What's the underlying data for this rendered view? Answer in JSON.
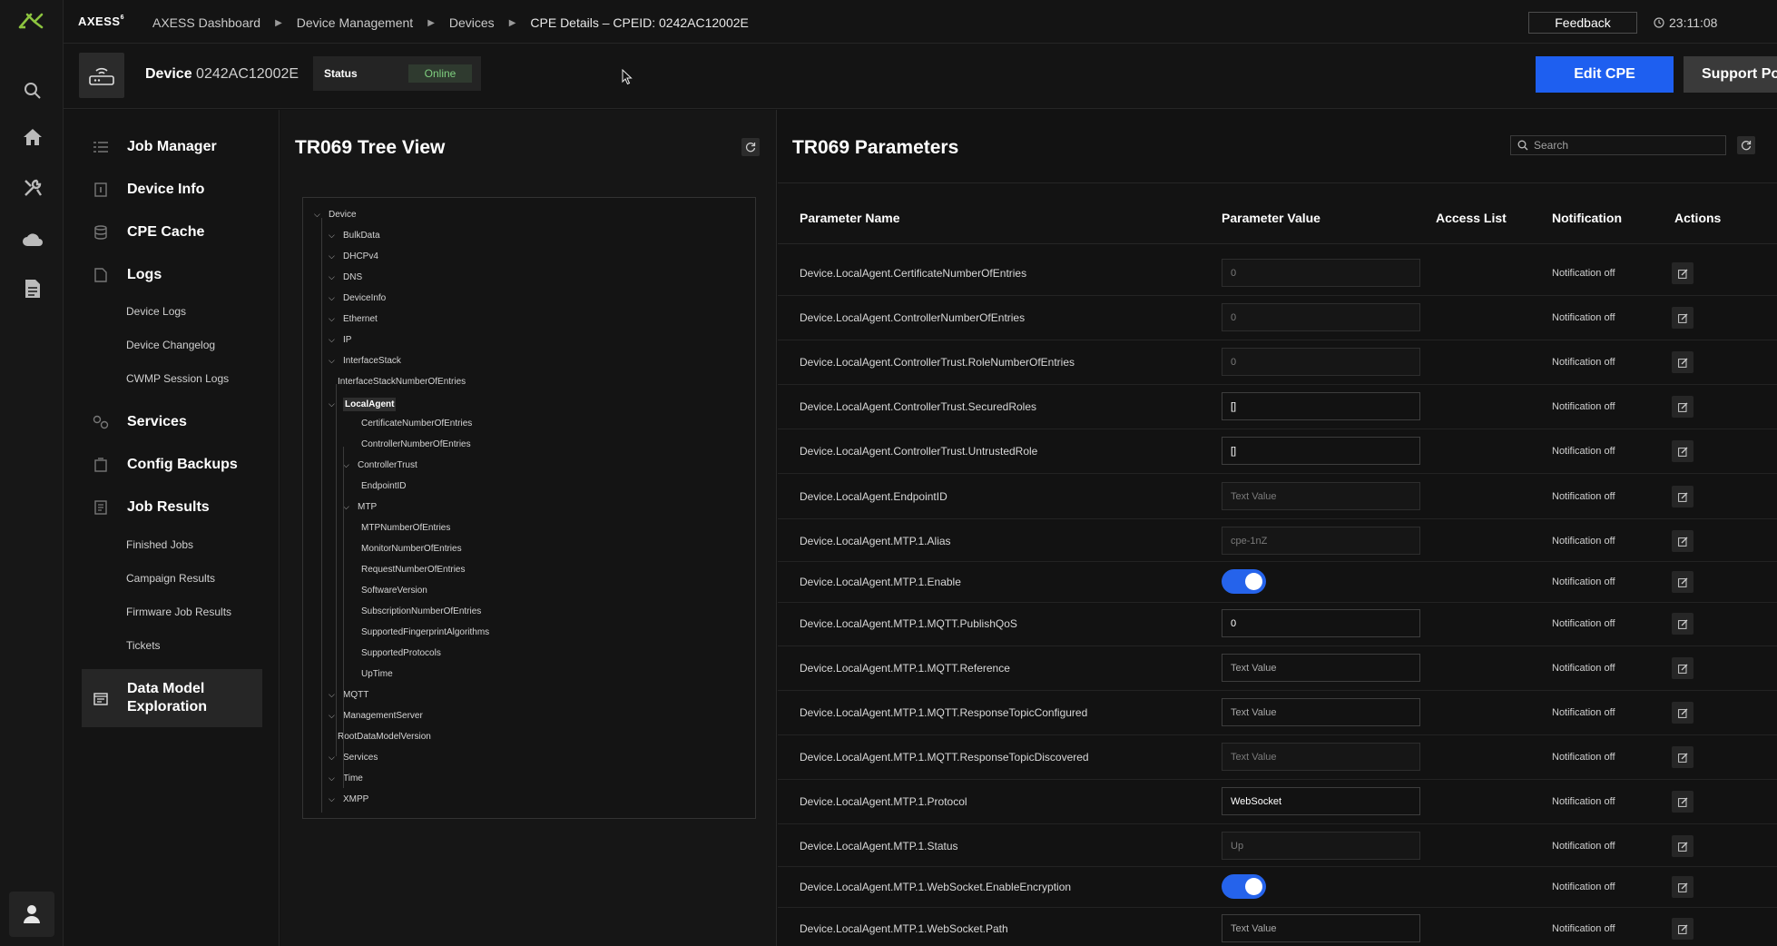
{
  "topbar": {
    "brand": "AXESS",
    "brand_version": "6",
    "breadcrumbs": [
      "AXESS Dashboard",
      "Device Management",
      "Devices",
      "CPE Details – CPEID: 0242AC12002E"
    ],
    "feedback_label": "Feedback",
    "time": "23:11:08"
  },
  "device": {
    "title_label": "Device",
    "id": "0242AC12002E",
    "status_label": "Status",
    "status_value": "Online",
    "edit_label": "Edit CPE",
    "support_label": "Support Portal"
  },
  "rail_icons": [
    "search-icon",
    "home-icon",
    "tools-icon",
    "cloud-icon",
    "document-icon",
    "user-icon"
  ],
  "nav": {
    "job_manager": "Job Manager",
    "device_info": "Device Info",
    "cpe_cache": "CPE Cache",
    "logs": "Logs",
    "logs_sub": [
      "Device Logs",
      "Device Changelog",
      "CWMP Session Logs"
    ],
    "services": "Services",
    "config_backups": "Config Backups",
    "job_results": "Job Results",
    "job_results_sub": [
      "Finished Jobs",
      "Campaign Results",
      "Firmware Job Results",
      "Tickets"
    ],
    "data_model_line1": "Data Model",
    "data_model_line2": "Exploration"
  },
  "tree": {
    "title": "TR069 Tree View",
    "nodes": [
      {
        "label": "Device",
        "level": 0,
        "expandable": true
      },
      {
        "label": "BulkData",
        "level": 1,
        "expandable": true
      },
      {
        "label": "DHCPv4",
        "level": 1,
        "expandable": true
      },
      {
        "label": "DNS",
        "level": 1,
        "expandable": true
      },
      {
        "label": "DeviceInfo",
        "level": 1,
        "expandable": true
      },
      {
        "label": "Ethernet",
        "level": 1,
        "expandable": true
      },
      {
        "label": "IP",
        "level": 1,
        "expandable": true
      },
      {
        "label": "InterfaceStack",
        "level": 1,
        "expandable": true
      },
      {
        "label": "InterfaceStackNumberOfEntries",
        "level": 1,
        "expandable": false
      },
      {
        "label": "LocalAgent",
        "level": 1,
        "expandable": true,
        "selected": true
      },
      {
        "label": "CertificateNumberOfEntries",
        "level": 2,
        "expandable": false
      },
      {
        "label": "ControllerNumberOfEntries",
        "level": 2,
        "expandable": false
      },
      {
        "label": "ControllerTrust",
        "level": 2,
        "expandable": true
      },
      {
        "label": "EndpointID",
        "level": 2,
        "expandable": false
      },
      {
        "label": "MTP",
        "level": 2,
        "expandable": true
      },
      {
        "label": "MTPNumberOfEntries",
        "level": 2,
        "expandable": false
      },
      {
        "label": "MonitorNumberOfEntries",
        "level": 2,
        "expandable": false
      },
      {
        "label": "RequestNumberOfEntries",
        "level": 2,
        "expandable": false
      },
      {
        "label": "SoftwareVersion",
        "level": 2,
        "expandable": false
      },
      {
        "label": "SubscriptionNumberOfEntries",
        "level": 2,
        "expandable": false
      },
      {
        "label": "SupportedFingerprintAlgorithms",
        "level": 2,
        "expandable": false
      },
      {
        "label": "SupportedProtocols",
        "level": 2,
        "expandable": false
      },
      {
        "label": "UpTime",
        "level": 2,
        "expandable": false
      },
      {
        "label": "MQTT",
        "level": 1,
        "expandable": true
      },
      {
        "label": "ManagementServer",
        "level": 1,
        "expandable": true
      },
      {
        "label": "RootDataModelVersion",
        "level": 1,
        "expandable": false
      },
      {
        "label": "Services",
        "level": 1,
        "expandable": true
      },
      {
        "label": "Time",
        "level": 1,
        "expandable": true
      },
      {
        "label": "XMPP",
        "level": 1,
        "expandable": true
      }
    ]
  },
  "params": {
    "title": "TR069 Parameters",
    "search_placeholder": "Search",
    "headers": {
      "name": "Parameter Name",
      "value": "Parameter Value",
      "access": "Access List",
      "notification": "Notification",
      "actions": "Actions"
    },
    "rows": [
      {
        "name": "Device.LocalAgent.CertificateNumberOfEntries",
        "kind": "readonly",
        "value": "0",
        "notification": "Notification off"
      },
      {
        "name": "Device.LocalAgent.ControllerNumberOfEntries",
        "kind": "readonly",
        "value": "0",
        "notification": "Notification off"
      },
      {
        "name": "Device.LocalAgent.ControllerTrust.RoleNumberOfEntries",
        "kind": "readonly",
        "value": "0",
        "notification": "Notification off"
      },
      {
        "name": "Device.LocalAgent.ControllerTrust.SecuredRoles",
        "kind": "edit",
        "value": "[]",
        "notification": "Notification off"
      },
      {
        "name": "Device.LocalAgent.ControllerTrust.UntrustedRole",
        "kind": "edit",
        "value": "[]",
        "notification": "Notification off"
      },
      {
        "name": "Device.LocalAgent.EndpointID",
        "kind": "readonly",
        "value": "Text Value",
        "notification": "Notification off"
      },
      {
        "name": "Device.LocalAgent.MTP.1.Alias",
        "kind": "readonly",
        "value": "cpe-1nZ",
        "notification": "Notification off"
      },
      {
        "name": "Device.LocalAgent.MTP.1.Enable",
        "kind": "toggle",
        "value": true,
        "notification": "Notification off"
      },
      {
        "name": "Device.LocalAgent.MTP.1.MQTT.PublishQoS",
        "kind": "edit",
        "value": "0",
        "notification": "Notification off"
      },
      {
        "name": "Device.LocalAgent.MTP.1.MQTT.Reference",
        "kind": "edit-ph",
        "value": "Text Value",
        "notification": "Notification off"
      },
      {
        "name": "Device.LocalAgent.MTP.1.MQTT.ResponseTopicConfigured",
        "kind": "edit-ph",
        "value": "Text Value",
        "notification": "Notification off"
      },
      {
        "name": "Device.LocalAgent.MTP.1.MQTT.ResponseTopicDiscovered",
        "kind": "readonly",
        "value": "Text Value",
        "notification": "Notification off"
      },
      {
        "name": "Device.LocalAgent.MTP.1.Protocol",
        "kind": "edit",
        "value": "WebSocket",
        "notification": "Notification off"
      },
      {
        "name": "Device.LocalAgent.MTP.1.Status",
        "kind": "readonly",
        "value": "Up",
        "notification": "Notification off"
      },
      {
        "name": "Device.LocalAgent.MTP.1.WebSocket.EnableEncryption",
        "kind": "toggle",
        "value": true,
        "notification": "Notification off"
      },
      {
        "name": "Device.LocalAgent.MTP.1.WebSocket.Path",
        "kind": "edit-ph",
        "value": "Text Value",
        "notification": "Notification off"
      }
    ]
  }
}
